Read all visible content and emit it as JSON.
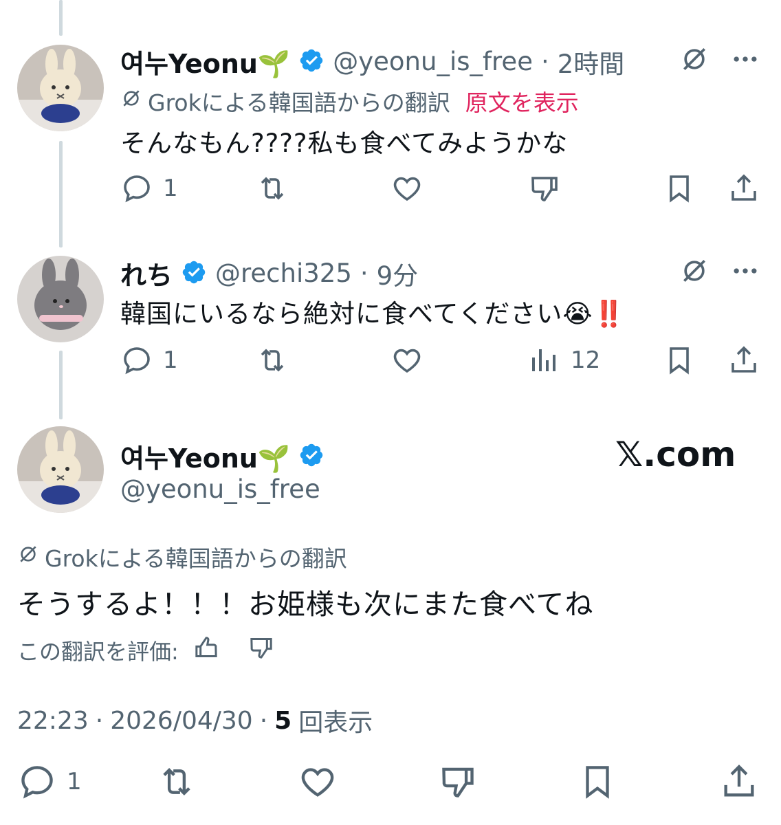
{
  "tweets": [
    {
      "name": "여누Yeonu🌱",
      "handle": "@yeonu_is_free",
      "time": "2時間",
      "translation_label": "Grokによる韓国語からの翻訳",
      "show_original": "原文を表示",
      "text": "そんなもん????私も食べてみようかな",
      "reply_count": "1"
    },
    {
      "name": "れち",
      "handle": "@rechi325",
      "time": "9分",
      "text": "韓国にいるなら絶対に食べてください😭‼️",
      "reply_count": "1",
      "views": "12"
    }
  ],
  "main": {
    "name": "여누Yeonu🌱",
    "handle": "@yeonu_is_free",
    "watermark": "𝕏.com",
    "translation_label": "Grokによる韓国語からの翻訳",
    "text": "そうするよ！！！お姫様も次にまた食べてね",
    "rate_label": "この翻訳を評価:",
    "time": "22:23",
    "date": "2026/04/30",
    "views_count": "5",
    "views_label": "回表示",
    "reply_count": "1"
  },
  "colors": {
    "verified": "#1d9bf0",
    "link_pink": "#e0245e",
    "secondary_text": "#536471",
    "thread_line": "#cfd9de"
  },
  "separator": "·"
}
